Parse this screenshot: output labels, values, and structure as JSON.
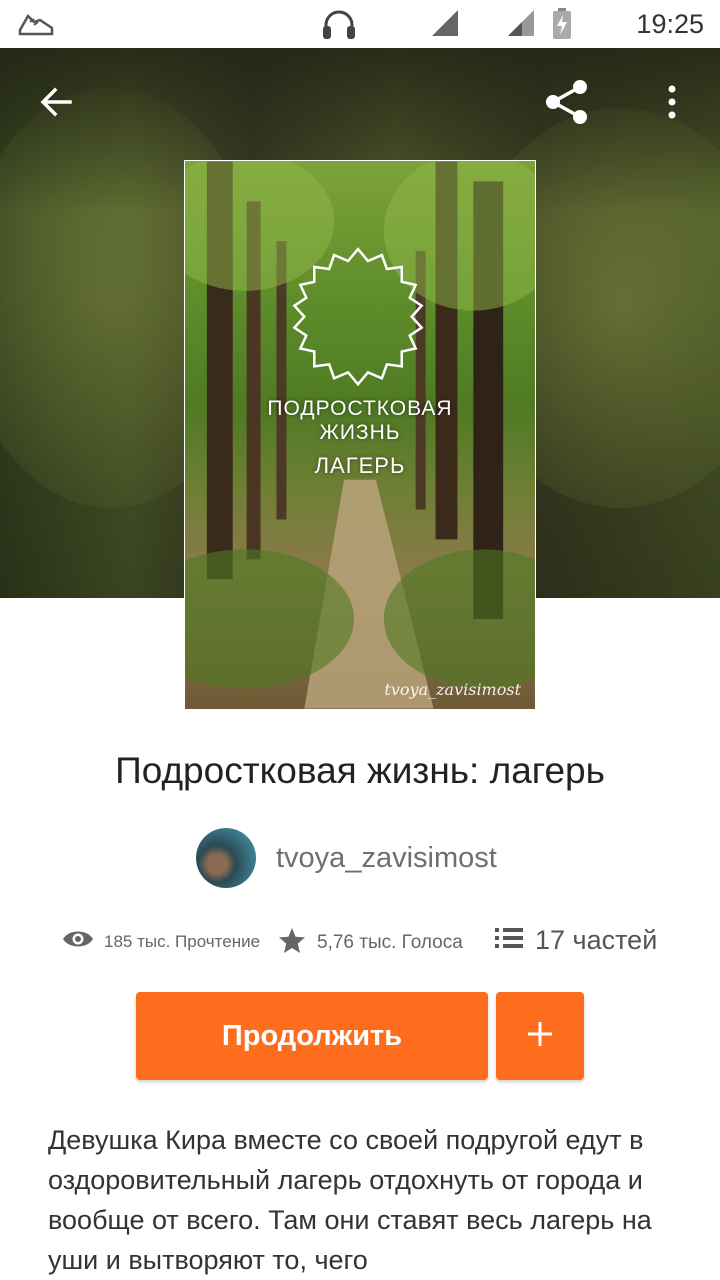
{
  "status_bar": {
    "time": "19:25",
    "icons": [
      "running-shoe-icon",
      "headset-icon",
      "signal-icon",
      "signal-icon",
      "battery-charging-icon"
    ]
  },
  "toolbar": {
    "back_icon": "arrow-left-icon",
    "share_icon": "share-icon",
    "more_icon": "more-vertical-icon"
  },
  "cover": {
    "line1": "ПОДРОСТКОВАЯ",
    "line2": "ЖИЗНЬ",
    "line3": "ЛАГЕРЬ",
    "signature": "tvoya_zavisimost"
  },
  "story": {
    "title": "Подростковая жизнь: лагерь",
    "author": "tvoya_zavisimost",
    "reads": "185 тыс. Прочтение",
    "votes": "5,76 тыс. Голоса",
    "parts": "17 частей",
    "continue_label": "Продолжить",
    "add_label": "+",
    "description": "Девушка Кира вместе со своей подругой едут в оздоровительный лагерь отдохнуть от города и вообще от всего. Там они ставят весь лагерь на уши и вытворяют то, чего"
  },
  "colors": {
    "accent": "#fe6c1e"
  }
}
